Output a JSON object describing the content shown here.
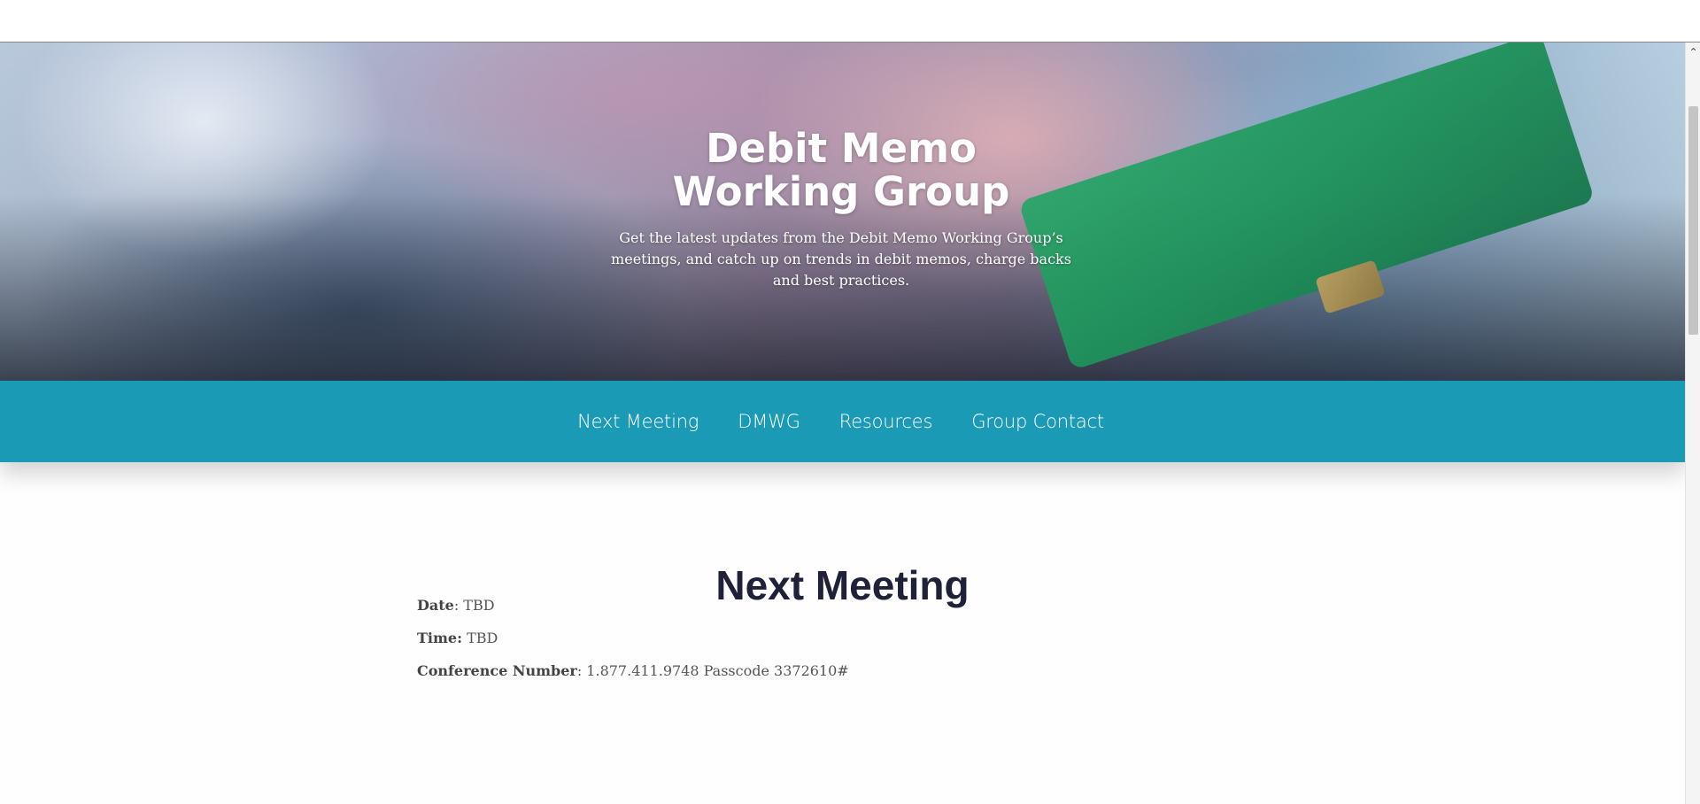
{
  "hero": {
    "title": "Debit Memo Working Group",
    "subtitle": "Get the latest updates from the Debit Memo Working Group’s meetings, and catch up on trends in debit memos, charge backs and best practices."
  },
  "nav": {
    "items": [
      {
        "label": "Next Meeting"
      },
      {
        "label": "DMWG"
      },
      {
        "label": "Resources"
      },
      {
        "label": "Group Contact"
      }
    ]
  },
  "next_meeting": {
    "heading": "Next Meeting",
    "date_label": "Date",
    "date_value": ": TBD",
    "time_label": "Time:",
    "time_value": " TBD",
    "conference_label": "Conference Number",
    "conference_value": ": 1.877.411.9748 Passcode 3372610#"
  },
  "colors": {
    "nav_background": "#1b9ab5",
    "heading_text": "#1f2139",
    "card_green": "#1d8f58"
  },
  "icons": {
    "scroll_up": "chevron-up-icon"
  }
}
